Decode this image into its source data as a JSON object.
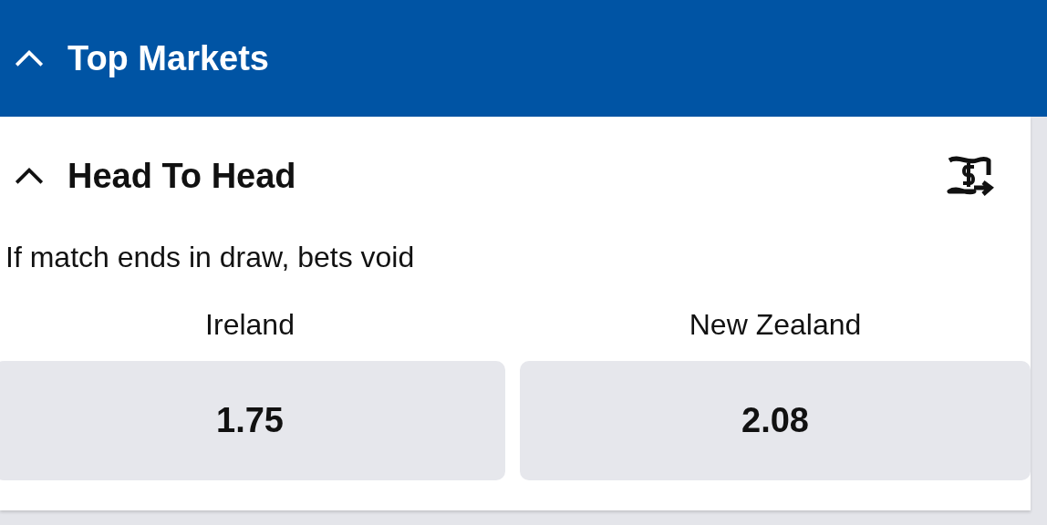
{
  "section": {
    "title": "Top Markets",
    "expanded": true
  },
  "market": {
    "title": "Head To Head",
    "expanded": true,
    "note": "If match ends in draw, bets void",
    "selections": [
      {
        "team": "Ireland",
        "odds": "1.75"
      },
      {
        "team": "New Zealand",
        "odds": "2.08"
      }
    ]
  }
}
